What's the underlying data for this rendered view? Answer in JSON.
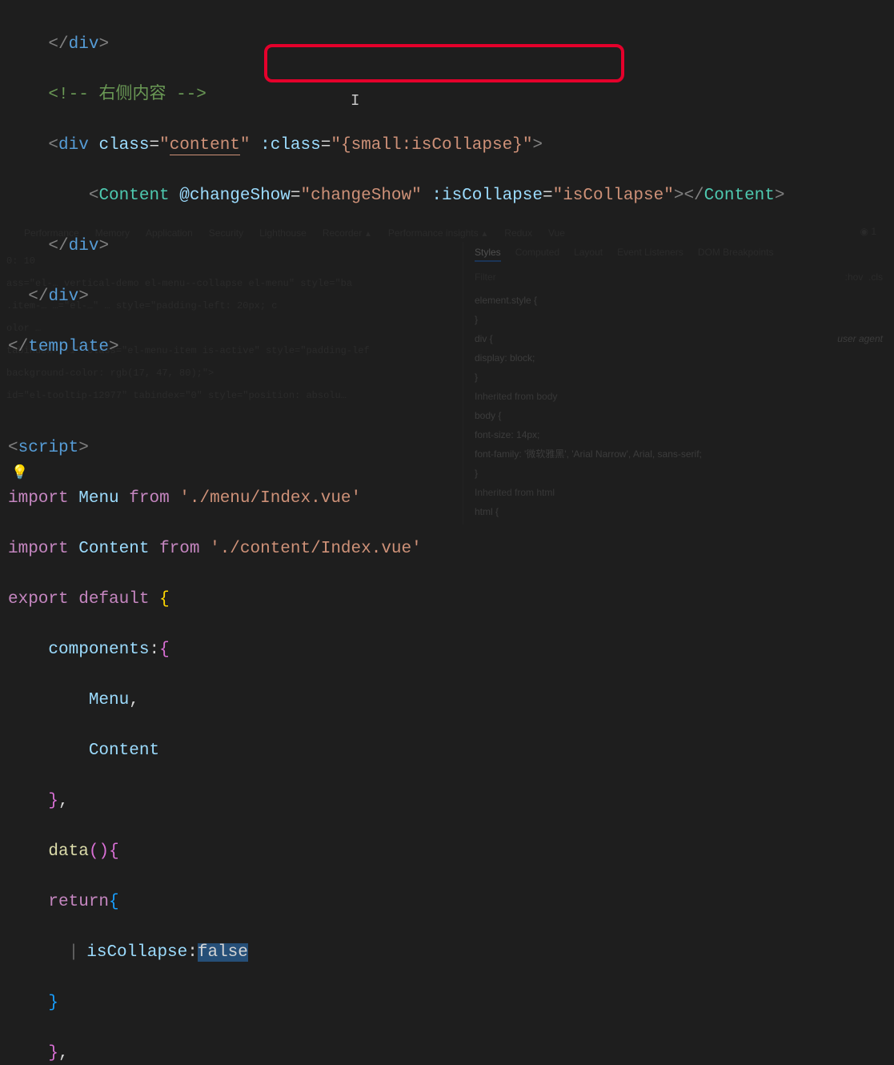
{
  "code": {
    "l1": {
      "ind": "    ",
      "close_div": "</div>"
    },
    "l2": {
      "ind": "    ",
      "c_open": "<!--",
      "c_text": " 右侧内容 ",
      "c_close": "-->"
    },
    "l3": {
      "ind": "    ",
      "lt": "<",
      "tag": "div",
      "attr_class": "class",
      "eq": "=",
      "q": "\"",
      "v_content": "content",
      "space": " ",
      "attr_dclass": ":class",
      "v_dclass": "{small:isCollapse}",
      "gt": ">"
    },
    "l4": {
      "ind": "        ",
      "lt": "<",
      "tag": "Content",
      "attr_chg": "@changeShow",
      "v_chg": "changeShow",
      "attr_col": ":isCollapse",
      "v_col": "isCollapse",
      "gt": ">",
      "ltc": "</",
      "gtc": ">"
    },
    "l5": {
      "ind": "    ",
      "close_div": "</div>"
    },
    "l6": {
      "ind": "  ",
      "close_div": "</div>"
    },
    "l7": {
      "close_tpl": "</template>"
    },
    "l9": {
      "open_script": "<script>"
    },
    "l10": {
      "kw1": "import",
      "id": "Menu",
      "kw2": "from",
      "path": "'./menu/Index.vue'"
    },
    "l11": {
      "kw1": "import",
      "id": "Content",
      "kw2": "from",
      "path": "'./content/Index.vue'"
    },
    "l12": {
      "kw1": "export",
      "kw2": "default",
      "brace": "{"
    },
    "l13": {
      "ind": "    ",
      "key": "components",
      "colon": ":",
      "brace": "{"
    },
    "l14": {
      "ind": "        ",
      "id": "Menu",
      "comma": ","
    },
    "l15": {
      "ind": "        ",
      "id": "Content"
    },
    "l16": {
      "ind": "    ",
      "brace": "}",
      "comma": ","
    },
    "l17": {
      "ind": "    ",
      "fn": "data",
      "paren": "()",
      "brace": "{"
    },
    "l18": {
      "ind": "    ",
      "kw": "return",
      "brace": "{"
    },
    "l19": {
      "ind": "      ",
      "id": "isCollapse",
      "colon": ":",
      "val": "false"
    },
    "l20": {
      "ind": "    ",
      "brace": "}"
    },
    "l21": {
      "ind": "    ",
      "brace": "}",
      "comma": ","
    }
  },
  "devtools": {
    "tabs": [
      "Performance",
      "Memory",
      "Application",
      "Security",
      "Lighthouse",
      "Recorder",
      "Performance insights",
      "Redux",
      "Vue"
    ],
    "subtabs": [
      "Styles",
      "Computed",
      "Layout",
      "Event Listeners",
      "DOM Breakpoints"
    ],
    "filter": "Filter",
    "hov": ":hov",
    "cls": ".cls",
    "elements_left": {
      "l1": "0: 10",
      "l2": "ass=\"el-…    vertical-demo el-menu--collapse el-menu\" style=\"ba",
      "l3": ".item-… …=\"el-…\"  …  style=\"padding-left: 20px; c",
      "l4": "olor …",
      "l5": "tabindex=\"-1\" class=\"el-menu-item is-active\" style=\"padding-lef",
      "l6": "background-color: rgb(17, 47, 80);\">",
      "l7": "id=\"el-tooltip-12977\" tabindex=\"0\" style=\"position: absolu…"
    },
    "styles": {
      "s1": "element.style {",
      "s1c": "}",
      "s2": "div {",
      "s2u": "user agent",
      "s2a": "  display: block;",
      "s2c": "}",
      "inh1": "Inherited from body",
      "s3": "body {",
      "s3a": "  font-size: 14px;",
      "s3b": "  font-family: '微软雅黑', 'Arial Narrow', Arial, sans-serif;",
      "s3c": "}",
      "inh2": "Inherited from html",
      "s4": "html {"
    }
  }
}
